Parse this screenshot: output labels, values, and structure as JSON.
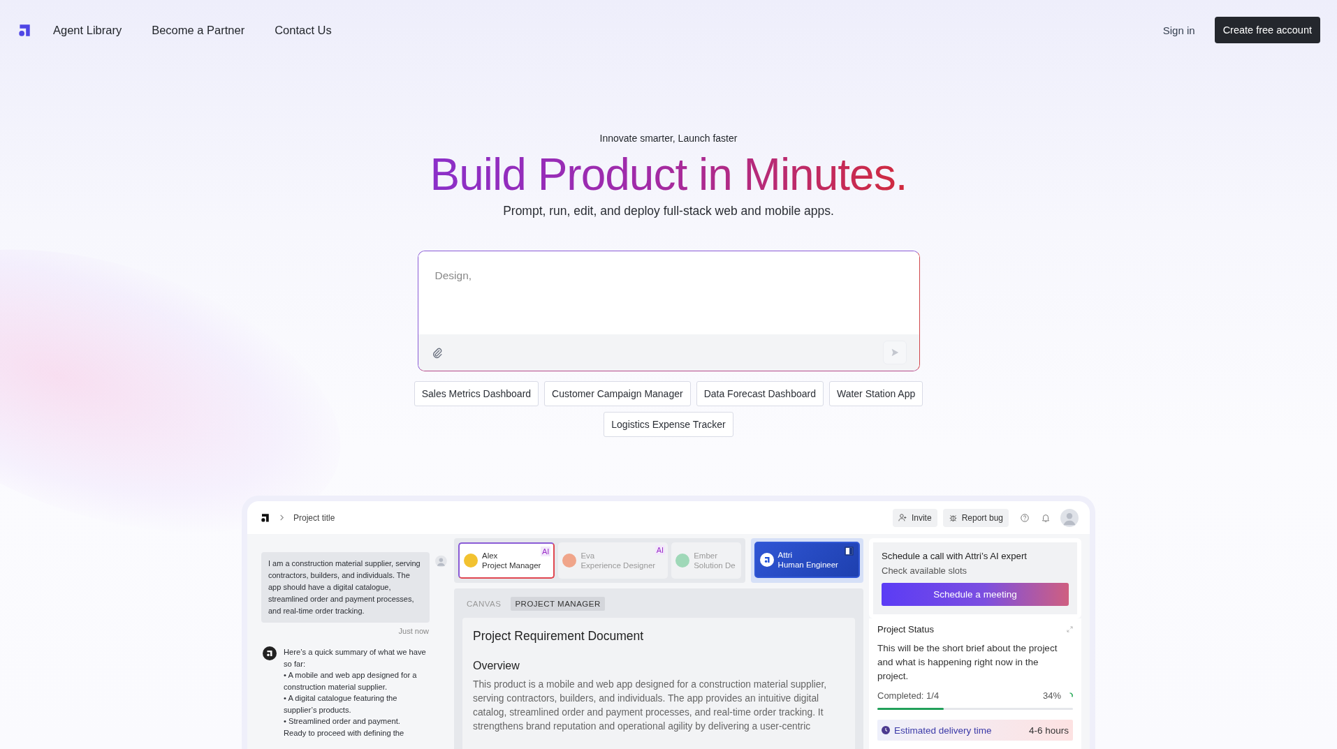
{
  "nav": {
    "links": [
      "Agent Library",
      "Become a Partner",
      "Contact Us"
    ],
    "sign_in": "Sign in",
    "cta": "Create free account"
  },
  "hero": {
    "tagline": "Innovate smarter, Launch faster",
    "title": "Build Product in Minutes.",
    "subtitle": "Prompt, run, edit, and deploy full-stack web and mobile apps."
  },
  "prompt": {
    "placeholder": "Design,"
  },
  "suggestions": [
    "Sales Metrics Dashboard",
    "Customer Campaign Manager",
    "Data Forecast Dashboard",
    "Water Station App",
    "Logistics Expense Tracker"
  ],
  "preview": {
    "breadcrumb": "Project title",
    "actions": [
      {
        "kind": "invite",
        "label": "Invite"
      },
      {
        "kind": "bug",
        "label": "Report bug"
      }
    ],
    "chat": [
      {
        "kind": "user",
        "text": "I am a construction material supplier, serving contractors, builders, and individuals. The app should have a digital catalogue, streamlined order and payment processes, and real-time order tracking.",
        "time": "Just now"
      },
      {
        "kind": "assistant",
        "lines": [
          "Here’s a quick summary of what we have so far:",
          "• A mobile and web app designed for a construction material supplier.",
          "• A digital catalogue featuring the supplier’s products.",
          "• Streamlined order and payment.",
          "Ready to proceed with defining the"
        ]
      }
    ],
    "agents": [
      {
        "kind": "agent",
        "name": "Alex",
        "role": "Project Manager",
        "badge": "AI",
        "selected": true,
        "color": "#f2c230"
      },
      {
        "kind": "agent",
        "name": "Eva",
        "role": "Experience Designer",
        "badge": "AI",
        "selected": false,
        "color": "#f0a58a"
      },
      {
        "kind": "agent",
        "name": "Ember",
        "role": "Solution De",
        "selected": false,
        "color": "#9fd8b8"
      },
      {
        "kind": "human",
        "name": "Attri",
        "role": "Human Engineer",
        "selected": false,
        "color": "#ffffff"
      }
    ],
    "canvas_tabs": [
      {
        "label": "CANVAS",
        "selected": false
      },
      {
        "label": "PROJECT MANAGER",
        "selected": true
      }
    ],
    "document": {
      "title": "Project Requirement Document",
      "section": "Overview",
      "body": "This product is a mobile and web app designed for a construction material supplier, serving contractors, builders, and individuals. The app provides an intuitive digital catalog, streamlined order and payment processes, and real-time order tracking. It strengthens brand reputation and operational agility by delivering a user-centric"
    },
    "schedule": {
      "title": "Schedule a call with Attri’s AI expert",
      "subtitle": "Check available slots",
      "button": "Schedule a meeting"
    },
    "status": {
      "title": "Project Status",
      "description": "This will be the short brief about the project and what is happening right now in the project.",
      "completed": "Completed: 1/4",
      "percent": "34%",
      "level": 0.34,
      "delivery_label": "Estimated delivery time",
      "delivery_time": "4-6 hours"
    }
  }
}
